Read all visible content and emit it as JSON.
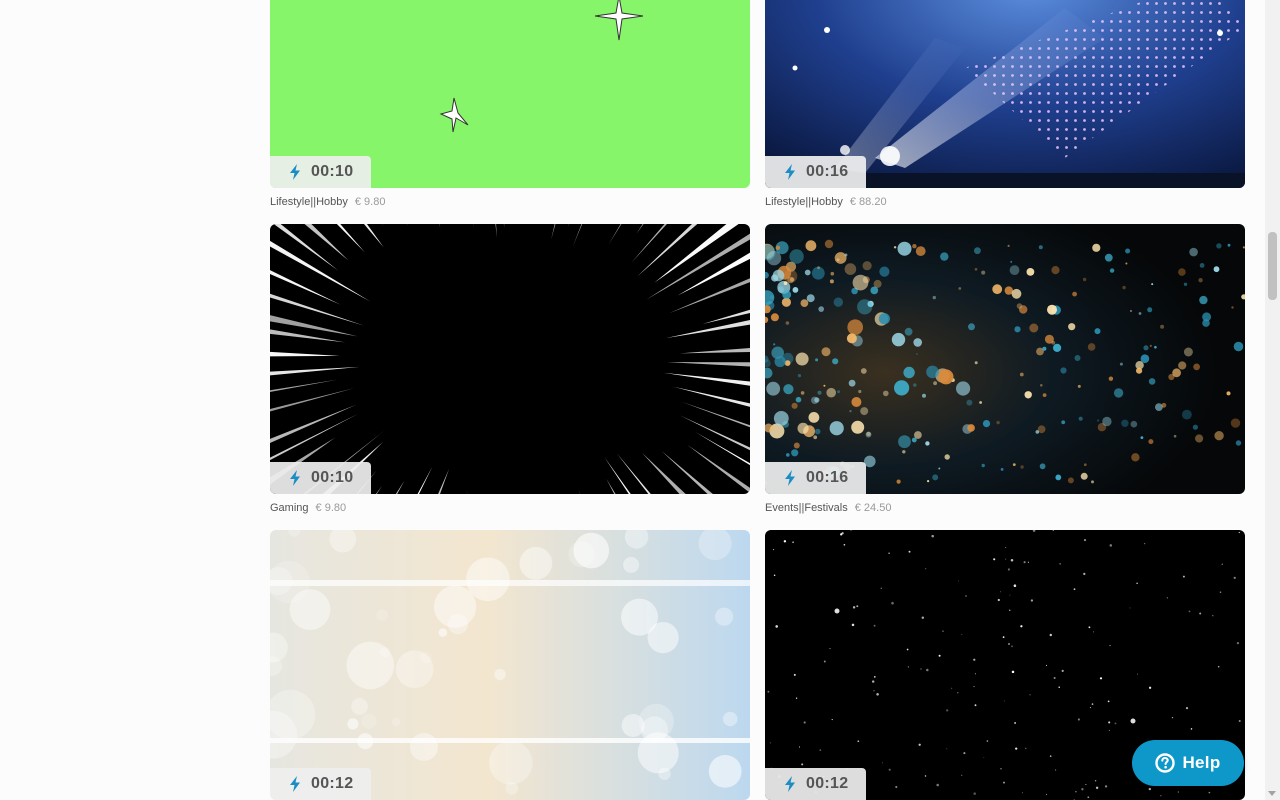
{
  "videos": [
    {
      "duration": "00:10",
      "category": "Lifestyle||Hobby",
      "price": "€ 9.80",
      "thumbnail": "green-screen-sparkles"
    },
    {
      "duration": "00:16",
      "category": "Lifestyle||Hobby",
      "price": "€ 88.20",
      "thumbnail": "stage-lights-dots"
    },
    {
      "duration": "00:10",
      "category": "Gaming",
      "price": "€ 9.80",
      "thumbnail": "anime-speed-lines"
    },
    {
      "duration": "00:16",
      "category": "Events||Festivals",
      "price": "€ 24.50",
      "thumbnail": "bokeh-particles"
    },
    {
      "duration": "00:12",
      "category": "",
      "price": "",
      "thumbnail": "soft-light-bokeh"
    },
    {
      "duration": "00:12",
      "category": "",
      "price": "",
      "thumbnail": "starfield-space"
    }
  ],
  "help_button": {
    "label": "Help",
    "icon": "question-circle-icon"
  },
  "icons": {
    "duration": "lightning-bolt-icon"
  },
  "colors": {
    "accent": "#0e98c9",
    "green_screen": "#86f56a",
    "badge_bg": "#eeeeee"
  }
}
